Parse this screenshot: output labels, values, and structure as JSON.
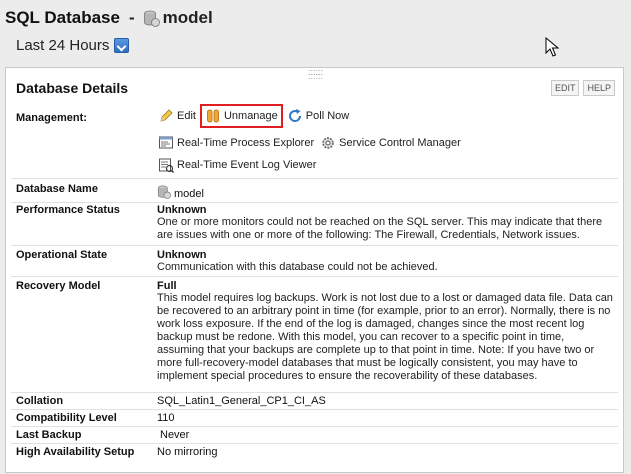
{
  "header": {
    "title": "SQL Database",
    "separator": "-",
    "db_name": "model",
    "time_range": "Last 24 Hours"
  },
  "panel": {
    "title": "Database Details",
    "edit_label": "EDIT",
    "help_label": "HELP"
  },
  "management": {
    "label": "Management:",
    "edit": "Edit",
    "unmanage": "Unmanage",
    "poll_now": "Poll Now",
    "rtpe": "Real-Time Process Explorer",
    "scm": "Service Control Manager",
    "rtelv": "Real-Time Event Log Viewer"
  },
  "details": {
    "database_name": {
      "label": "Database Name",
      "value": "model"
    },
    "performance_status": {
      "label": "Performance Status",
      "value": "Unknown",
      "description": "One or more monitors could not be reached on the SQL server. This may indicate that there are issues with one or more of the following: The Firewall, Credentials, Network issues."
    },
    "operational_state": {
      "label": "Operational State",
      "value": "Unknown",
      "description": "Communication with this database could not be achieved."
    },
    "recovery_model": {
      "label": "Recovery Model",
      "value": "Full",
      "description": "This model requires log backups. Work is not lost due to a lost or damaged data file. Data can be recovered to an arbitrary point in time (for example, prior to an error). Normally, there is no work loss exposure. If the end of the log is damaged, changes since the most recent log backup must be redone. With this model, you can recover to a specific point in time, assuming that your backups are complete up to that point in time. Note: If you have two or more full-recovery-model databases that must be logically consistent, you may have to implement special procedures to ensure the recoverability of these databases."
    },
    "collation": {
      "label": "Collation",
      "value": "SQL_Latin1_General_CP1_CI_AS"
    },
    "compatibility_level": {
      "label": "Compatibility Level",
      "value": "110"
    },
    "last_backup": {
      "label": "Last Backup",
      "value": "Never"
    },
    "high_availability": {
      "label": "High Availability Setup",
      "value": "No mirroring"
    }
  }
}
